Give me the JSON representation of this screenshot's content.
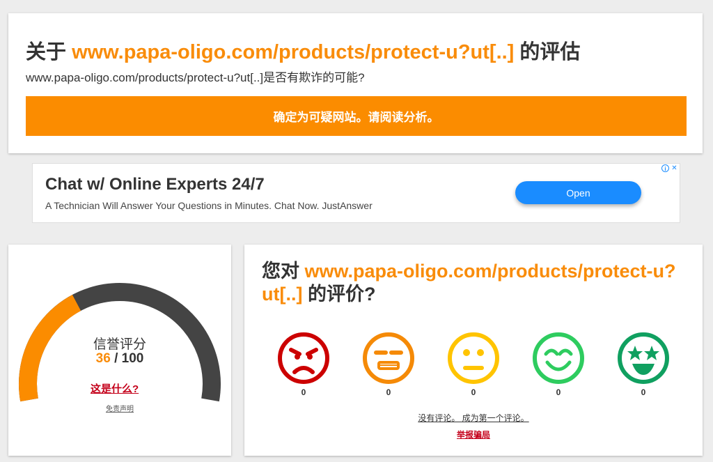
{
  "header": {
    "title_prefix": "关于 ",
    "title_url": "www.papa-oligo.com/products/protect-u?ut[..]",
    "title_suffix": " 的评估",
    "subtitle": "www.papa-oligo.com/products/protect-u?ut[..]是否有欺诈的可能?",
    "verdict": "确定为可疑网站。请阅读分析。",
    "verdict_color": "#fb8c00"
  },
  "ad": {
    "title": "Chat w/ Online Experts 24/7",
    "description": "A Technician Will Answer Your Questions in Minutes. Chat Now. JustAnswer",
    "button_label": "Open",
    "info_icon": "i",
    "close_icon": "✕",
    "button_color": "#1a8cff"
  },
  "score": {
    "label": "信誉评分",
    "value": "36",
    "max": "/ 100",
    "what_link": "这是什么?",
    "disclaimer": "免责声明",
    "fill_fraction": 0.36,
    "fill_color": "#fb8c00",
    "track_color": "#444444"
  },
  "rating": {
    "title_prefix": "您对 ",
    "title_url": "www.papa-oligo.com/products/protect-u?ut[..]",
    "title_suffix": " 的评价?",
    "faces": [
      {
        "name": "angry-face-icon",
        "color": "#cc0000",
        "count": "0"
      },
      {
        "name": "annoyed-face-icon",
        "color": "#f58a07",
        "count": "0"
      },
      {
        "name": "neutral-face-icon",
        "color": "#ffc400",
        "count": "0"
      },
      {
        "name": "happy-face-icon",
        "color": "#2ecc5f",
        "count": "0"
      },
      {
        "name": "star-eyes-face-icon",
        "color": "#10a060",
        "count": "0"
      }
    ],
    "no_reviews": "没有评论。 成为第一个评论。",
    "report": "举报骗局"
  }
}
